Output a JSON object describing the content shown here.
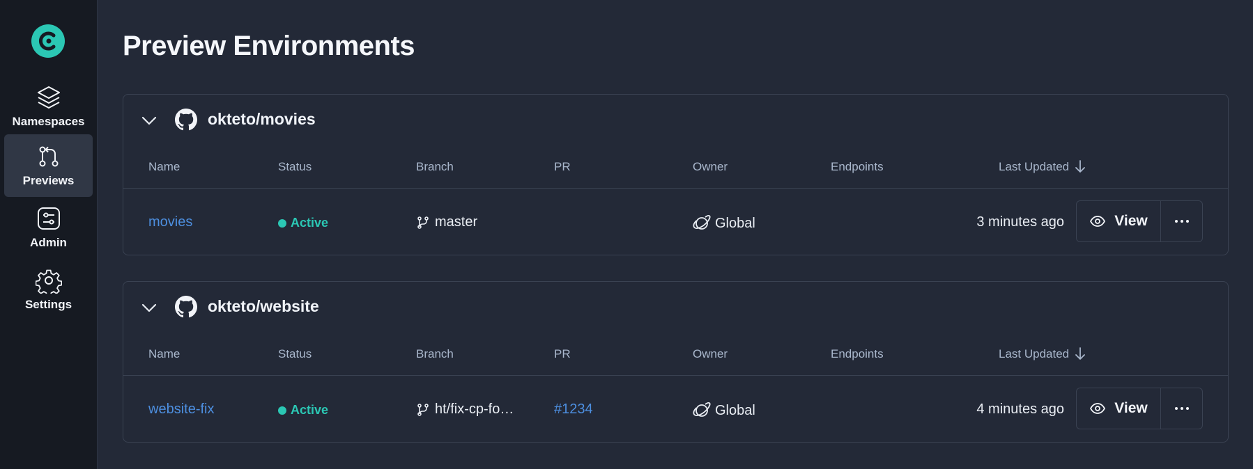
{
  "sidebar": {
    "logo": "okteto-logo",
    "items": [
      {
        "label": "Namespaces",
        "icon": "layers-icon",
        "active": false
      },
      {
        "label": "Previews",
        "icon": "git-pull-request-icon",
        "active": true
      },
      {
        "label": "Admin",
        "icon": "sliders-icon",
        "active": false
      },
      {
        "label": "Settings",
        "icon": "gear-icon",
        "active": false
      }
    ]
  },
  "page": {
    "title": "Preview Environments"
  },
  "columns": {
    "name": "Name",
    "status": "Status",
    "branch": "Branch",
    "pr": "PR",
    "owner": "Owner",
    "endpoints": "Endpoints",
    "last_updated": "Last Updated"
  },
  "repos": [
    {
      "name": "okteto/movies",
      "rows": [
        {
          "name": "movies",
          "status": "Active",
          "branch": "master",
          "pr": "",
          "owner": "Global",
          "endpoints": "",
          "last_updated": "3 minutes ago",
          "view_label": "View"
        }
      ]
    },
    {
      "name": "okteto/website",
      "rows": [
        {
          "name": "website-fix",
          "status": "Active",
          "branch": "ht/fix-cp-fo…",
          "pr": "#1234",
          "owner": "Global",
          "endpoints": "",
          "last_updated": "4 minutes ago",
          "view_label": "View"
        }
      ]
    }
  ],
  "colors": {
    "accent": "#2bc7b4",
    "link": "#4d8fe0",
    "background": "#232937",
    "sidebar": "#161a22"
  }
}
